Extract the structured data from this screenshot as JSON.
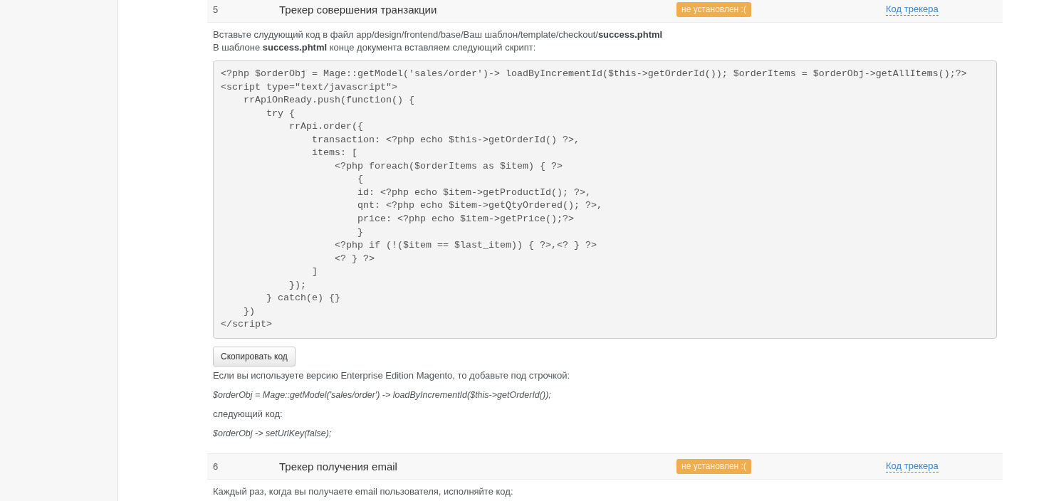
{
  "trackers": [
    {
      "number": "5",
      "title": "Трекер совершения транзакции",
      "badge": {
        "text": "не установлен :(",
        "kind": "warning"
      },
      "link": "Код трекера",
      "content": [
        {
          "kind": "paragraph",
          "lines": [
            "Вставьте слудующий код в файл app/design/frontend/base/Ваш шаблон/template/checkout/**success.phtml**",
            "В шаблоне **success.phtml** конце документа вставляем следующий скрипт:"
          ]
        },
        {
          "kind": "code",
          "lines": [
            "<?php $orderObj = Mage::getModel('sales/order')-> loadByIncrementId($this->getOrderId()); $orderItems = $orderObj->getAllItems();?>",
            "<script type=\"text/javascript\">",
            "    rrApiOnReady.push(function() {",
            "        try {",
            "            rrApi.order({",
            "                transaction: <?php echo $this->getOrderId() ?>,",
            "                items: [",
            "                    <?php foreach($orderItems as $item) { ?>",
            "                        {",
            "                        id: <?php echo $item->getProductId(); ?>,",
            "                        qnt: <?php echo $item->getQtyOrdered(); ?>,",
            "                        price: <?php echo $item->getPrice();?>",
            "                        }",
            "                    <?php if (!($item == $last_item)) { ?>,<? } ?>",
            "                    <? } ?>",
            "                ]",
            "            });",
            "        } catch(e) {}",
            "    })",
            "</script>"
          ]
        },
        {
          "kind": "button",
          "label": "Скопировать код"
        },
        {
          "kind": "paragraph",
          "lines": [
            "Если вы используете версию Enterprise Edition Magento, то добавьте под строчкой:"
          ]
        },
        {
          "kind": "snippet",
          "text": "$orderObj = Mage::getModel('sales/order') -> loadByIncrementId($this->getOrderId());"
        },
        {
          "kind": "paragraph",
          "lines": [
            "следующий код:"
          ]
        },
        {
          "kind": "snippet",
          "text": "$orderObj -> setUrlKey(false);"
        }
      ]
    },
    {
      "number": "6",
      "title": "Трекер получения email",
      "badge": {
        "text": "не установлен :(",
        "kind": "warning"
      },
      "link": "Код трекера",
      "content": [
        {
          "kind": "paragraph",
          "lines": [
            "Каждый раз, когда вы получаете email пользователя, исполняйте код:"
          ]
        }
      ]
    }
  ]
}
